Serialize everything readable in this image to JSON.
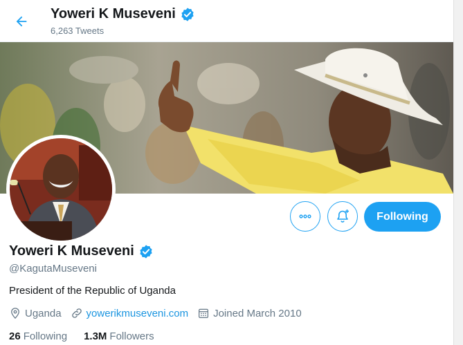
{
  "header": {
    "name": "Yoweri K Museveni",
    "tweet_count": "6,263 Tweets",
    "back_icon": "arrow-left-icon"
  },
  "profile": {
    "name": "Yoweri K Museveni",
    "handle": "@KagutaMuseveni",
    "bio": "President of the Republic of Uganda",
    "location": "Uganda",
    "website": "yowerikmuseveni.com",
    "joined": "Joined March 2010",
    "verified": true
  },
  "actions": {
    "more_icon": "more-horizontal-icon",
    "notify_icon": "bell-plus-icon",
    "following_label": "Following"
  },
  "stats": {
    "following_count": "26",
    "following_label": "Following",
    "followers_count": "1.3M",
    "followers_label": "Followers"
  },
  "colors": {
    "accent": "#1da1f2",
    "link": "#1b95e0",
    "muted": "#657786",
    "text": "#14171a"
  }
}
